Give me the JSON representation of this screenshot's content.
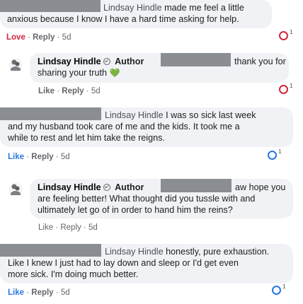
{
  "colors": {
    "love": "#d2263b",
    "like_ring": "#2577e6",
    "bubble": "#f0f2f5",
    "redact": "#8a8d91"
  },
  "comments": [
    {
      "author": "Lindsay Hindle",
      "text_a": "made me feel a little",
      "text_b": "anxious because I know I have a hard time asking for help.",
      "reaction_label": "Love",
      "reply": "Reply",
      "time": "5d",
      "reaction_count": "1",
      "reaction_icon": "love-reaction-icon"
    },
    {
      "author": "Lindsay Hindle",
      "badge": "Author",
      "text_a": "thank you for",
      "text_b": "sharing your truth",
      "emoji": "💚",
      "reaction_label": "Like",
      "reply": "Reply",
      "time": "5d",
      "reaction_count": "1",
      "reaction_icon": "love-reaction-icon"
    },
    {
      "author": "Lindsay Hindle",
      "text_a": "I was so sick last week",
      "text_b": "and my husband took care of me and the kids. It took me a",
      "text_c": "while to rest and let him take the reigns.",
      "reaction_label": "Like",
      "reply": "Reply",
      "time": "5d",
      "reaction_count": "1",
      "reaction_icon": "like-reaction-icon"
    },
    {
      "author": "Lindsay Hindle",
      "badge": "Author",
      "text_a": "aw hope you",
      "text_b": "are feeling better! What thought did you tussle with and",
      "text_c": "ultimately let go of in order to hand him the reins?",
      "reaction_label": "Like",
      "reply": "Reply",
      "time": "5d"
    },
    {
      "author": "Lindsay Hindle",
      "text_a": "honestly, pure exhaustion.",
      "text_b": "Like I knew I just had to lay down and sleep or I'd get even",
      "text_c": "more sick. I'm doing much better.",
      "reaction_label": "Like",
      "reply": "Reply",
      "time": "5d",
      "reaction_count": "1",
      "reaction_icon": "like-reaction-icon"
    }
  ],
  "separator": "·"
}
